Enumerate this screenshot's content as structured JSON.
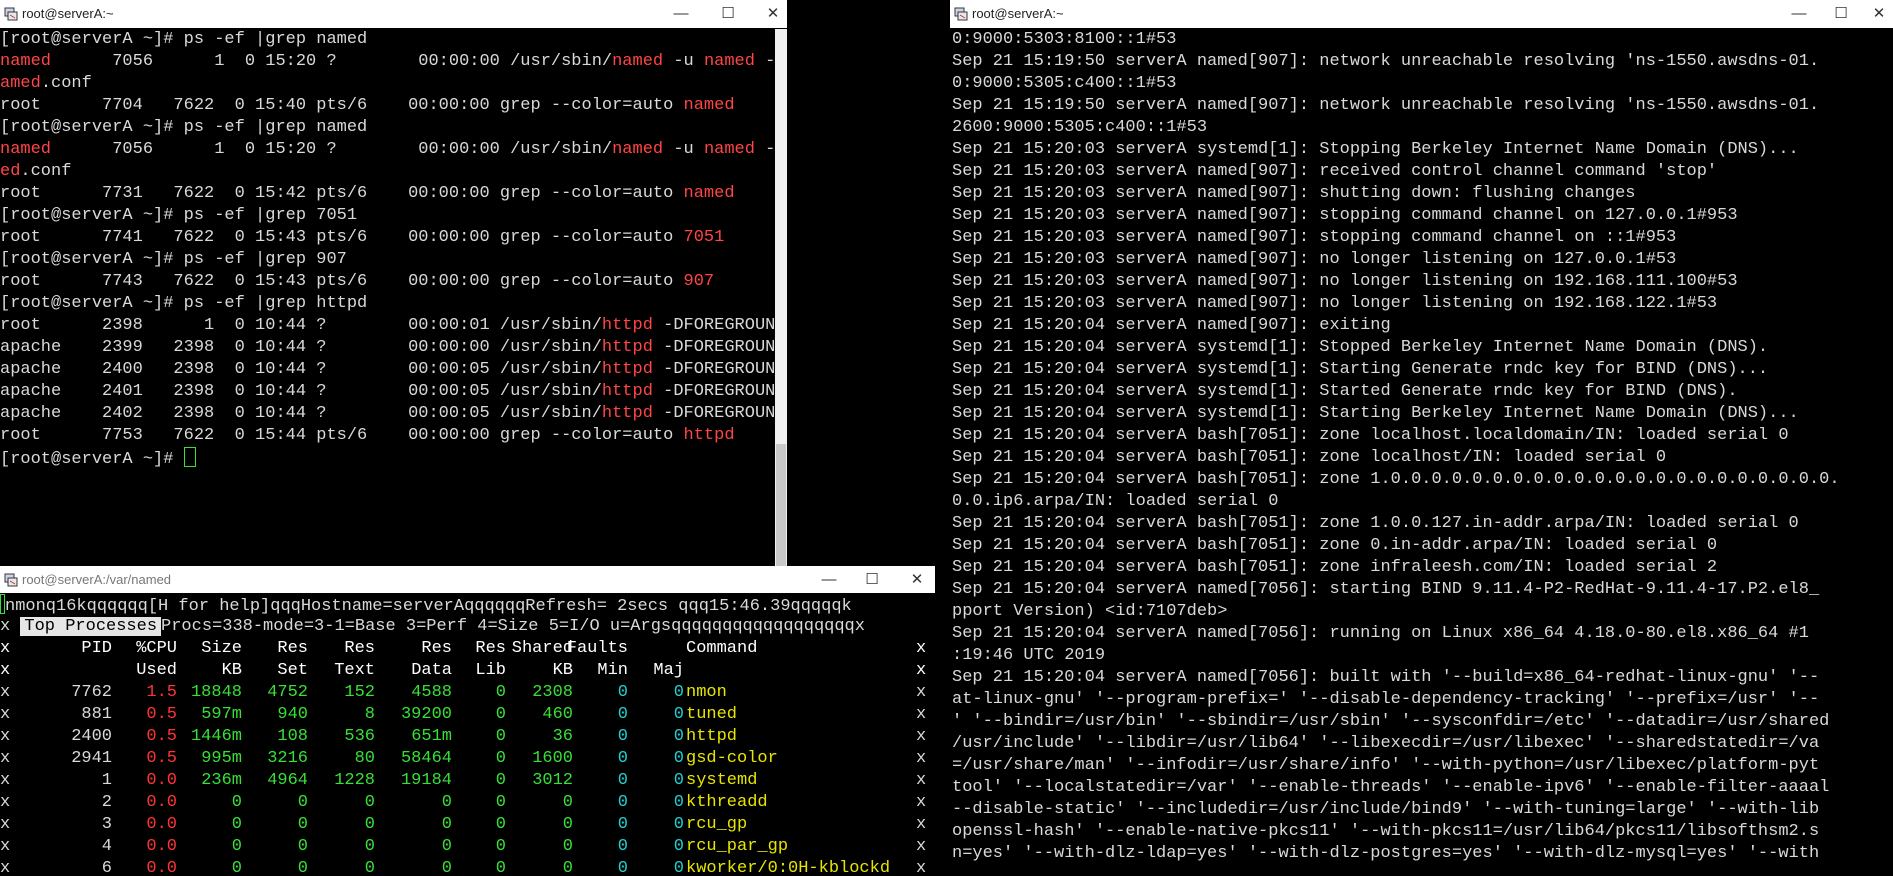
{
  "left_top": {
    "title": "root@serverA:~",
    "lines": [
      [
        [
          "[root@serverA ~]# ps -ef |grep named",
          0
        ]
      ],
      [
        [
          "named",
          1
        ],
        [
          "      7056      1  0 15:20 ?        00:00:00 /usr/sbin/",
          0
        ],
        [
          "named",
          1
        ],
        [
          " -u ",
          0
        ],
        [
          "named",
          1
        ],
        [
          " -c /etc/",
          0
        ],
        [
          "n",
          1
        ]
      ],
      [
        [
          "amed",
          1
        ],
        [
          ".conf",
          0
        ]
      ],
      [
        [
          "root      7704   7622  0 15:40 pts/6    00:00:00 grep --color=auto ",
          0
        ],
        [
          "named",
          1
        ]
      ],
      [
        [
          "[root@serverA ~]# ps -ef |grep named",
          0
        ]
      ],
      [
        [
          "named",
          1
        ],
        [
          "      7056      1  0 15:20 ?        00:00:00 /usr/sbin/",
          0
        ],
        [
          "named",
          1
        ],
        [
          " -u ",
          0
        ],
        [
          "named",
          1
        ],
        [
          " -c /etc/",
          0
        ],
        [
          "nam",
          1
        ]
      ],
      [
        [
          "ed",
          1
        ],
        [
          ".conf",
          0
        ]
      ],
      [
        [
          "root      7731   7622  0 15:42 pts/6    00:00:00 grep --color=auto ",
          0
        ],
        [
          "named",
          1
        ]
      ],
      [
        [
          "[root@serverA ~]# ps -ef |grep 7051",
          0
        ]
      ],
      [
        [
          "root      7741   7622  0 15:43 pts/6    00:00:00 grep --color=auto ",
          0
        ],
        [
          "7051",
          1
        ]
      ],
      [
        [
          "[root@serverA ~]# ps -ef |grep 907",
          0
        ]
      ],
      [
        [
          "root      7743   7622  0 15:43 pts/6    00:00:00 grep --color=auto ",
          0
        ],
        [
          "907",
          1
        ]
      ],
      [
        [
          "[root@serverA ~]# ps -ef |grep httpd",
          0
        ]
      ],
      [
        [
          "root      2398      1  0 10:44 ?        00:00:01 /usr/sbin/",
          0
        ],
        [
          "httpd",
          1
        ],
        [
          " -DFOREGROUND",
          0
        ]
      ],
      [
        [
          "apache    2399   2398  0 10:44 ?        00:00:00 /usr/sbin/",
          0
        ],
        [
          "httpd",
          1
        ],
        [
          " -DFOREGROUND",
          0
        ]
      ],
      [
        [
          "apache    2400   2398  0 10:44 ?        00:00:05 /usr/sbin/",
          0
        ],
        [
          "httpd",
          1
        ],
        [
          " -DFOREGROUND",
          0
        ]
      ],
      [
        [
          "apache    2401   2398  0 10:44 ?        00:00:05 /usr/sbin/",
          0
        ],
        [
          "httpd",
          1
        ],
        [
          " -DFOREGROUND",
          0
        ]
      ],
      [
        [
          "apache    2402   2398  0 10:44 ?        00:00:05 /usr/sbin/",
          0
        ],
        [
          "httpd",
          1
        ],
        [
          " -DFOREGROUND",
          0
        ]
      ],
      [
        [
          "root      7753   7622  0 15:44 pts/6    00:00:00 grep --color=auto ",
          0
        ],
        [
          "httpd",
          1
        ]
      ],
      [
        [
          "[root@serverA ~]# ",
          0
        ]
      ]
    ]
  },
  "left_bottom": {
    "title": "root@serverA:/var/named",
    "header_line": "nmonq16kqqqqqq[H for help]qqqHostname=serverAqqqqqqRefresh= 2secs qqq15:46.39qqqqqk",
    "top_label": "Top Processes",
    "mode_line": "Procs=338-mode=3-1=Base 3=Perf 4=Size 5=I/O u=Argsqqqqqqqqqqqqqqqqqqx",
    "col_headers_1": [
      "PID",
      "%CPU",
      "Size",
      "Res",
      "Res",
      "Res",
      "Res",
      "Shared",
      "Faults",
      "",
      "Command"
    ],
    "col_headers_2": [
      "",
      "Used",
      "KB",
      "Set",
      "Text",
      "Data",
      "Lib",
      "KB",
      "Min",
      "Maj",
      ""
    ],
    "rows": [
      {
        "pid": "7762",
        "cpu": "1.5",
        "size": "18848",
        "set": "4752",
        "text": "152",
        "data": "4588",
        "lib": "0",
        "shared": "2308",
        "min": "0",
        "maj": "0",
        "cmd": "nmon"
      },
      {
        "pid": "881",
        "cpu": "0.5",
        "size": "597m",
        "set": "940",
        "text": "8",
        "data": "39200",
        "lib": "0",
        "shared": "460",
        "min": "0",
        "maj": "0",
        "cmd": "tuned"
      },
      {
        "pid": "2400",
        "cpu": "0.5",
        "size": "1446m",
        "set": "108",
        "text": "536",
        "data": "651m",
        "lib": "0",
        "shared": "36",
        "min": "0",
        "maj": "0",
        "cmd": "httpd"
      },
      {
        "pid": "2941",
        "cpu": "0.5",
        "size": "995m",
        "set": "3216",
        "text": "80",
        "data": "58464",
        "lib": "0",
        "shared": "1600",
        "min": "0",
        "maj": "0",
        "cmd": "gsd-color"
      },
      {
        "pid": "1",
        "cpu": "0.0",
        "size": "236m",
        "set": "4964",
        "text": "1228",
        "data": "19184",
        "lib": "0",
        "shared": "3012",
        "min": "0",
        "maj": "0",
        "cmd": "systemd"
      },
      {
        "pid": "2",
        "cpu": "0.0",
        "size": "0",
        "set": "0",
        "text": "0",
        "data": "0",
        "lib": "0",
        "shared": "0",
        "min": "0",
        "maj": "0",
        "cmd": "kthreadd"
      },
      {
        "pid": "3",
        "cpu": "0.0",
        "size": "0",
        "set": "0",
        "text": "0",
        "data": "0",
        "lib": "0",
        "shared": "0",
        "min": "0",
        "maj": "0",
        "cmd": "rcu_gp"
      },
      {
        "pid": "4",
        "cpu": "0.0",
        "size": "0",
        "set": "0",
        "text": "0",
        "data": "0",
        "lib": "0",
        "shared": "0",
        "min": "0",
        "maj": "0",
        "cmd": "rcu_par_gp"
      },
      {
        "pid": "6",
        "cpu": "0.0",
        "size": "0",
        "set": "0",
        "text": "0",
        "data": "0",
        "lib": "0",
        "shared": "0",
        "min": "0",
        "maj": "0",
        "cmd": "kworker/0:0H-kblockd"
      }
    ]
  },
  "right": {
    "title": "root@serverA:~",
    "lines": [
      "0:9000:5303:8100::1#53",
      "Sep 21 15:19:50 serverA named[907]: network unreachable resolving 'ns-1550.awsdns-01.",
      "0:9000:5305:c400::1#53",
      "Sep 21 15:19:50 serverA named[907]: network unreachable resolving 'ns-1550.awsdns-01.",
      "2600:9000:5305:c400::1#53",
      "Sep 21 15:20:03 serverA systemd[1]: Stopping Berkeley Internet Name Domain (DNS)...",
      "Sep 21 15:20:03 serverA named[907]: received control channel command 'stop'",
      "Sep 21 15:20:03 serverA named[907]: shutting down: flushing changes",
      "Sep 21 15:20:03 serverA named[907]: stopping command channel on 127.0.0.1#953",
      "Sep 21 15:20:03 serverA named[907]: stopping command channel on ::1#953",
      "Sep 21 15:20:03 serverA named[907]: no longer listening on 127.0.0.1#53",
      "Sep 21 15:20:03 serverA named[907]: no longer listening on 192.168.111.100#53",
      "Sep 21 15:20:03 serverA named[907]: no longer listening on 192.168.122.1#53",
      "Sep 21 15:20:04 serverA named[907]: exiting",
      "Sep 21 15:20:04 serverA systemd[1]: Stopped Berkeley Internet Name Domain (DNS).",
      "Sep 21 15:20:04 serverA systemd[1]: Starting Generate rndc key for BIND (DNS)...",
      "Sep 21 15:20:04 serverA systemd[1]: Started Generate rndc key for BIND (DNS).",
      "Sep 21 15:20:04 serverA systemd[1]: Starting Berkeley Internet Name Domain (DNS)...",
      "Sep 21 15:20:04 serverA bash[7051]: zone localhost.localdomain/IN: loaded serial 0",
      "Sep 21 15:20:04 serverA bash[7051]: zone localhost/IN: loaded serial 0",
      "Sep 21 15:20:04 serverA bash[7051]: zone 1.0.0.0.0.0.0.0.0.0.0.0.0.0.0.0.0.0.0.0.0.0.0.",
      "0.0.ip6.arpa/IN: loaded serial 0",
      "Sep 21 15:20:04 serverA bash[7051]: zone 1.0.0.127.in-addr.arpa/IN: loaded serial 0",
      "Sep 21 15:20:04 serverA bash[7051]: zone 0.in-addr.arpa/IN: loaded serial 0",
      "Sep 21 15:20:04 serverA bash[7051]: zone infraleesh.com/IN: loaded serial 2",
      "Sep 21 15:20:04 serverA named[7056]: starting BIND 9.11.4-P2-RedHat-9.11.4-17.P2.el8_",
      "pport Version) <id:7107deb>",
      "Sep 21 15:20:04 serverA named[7056]: running on Linux x86_64 4.18.0-80.el8.x86_64 #1",
      ":19:46 UTC 2019",
      "Sep 21 15:20:04 serverA named[7056]: built with '--build=x86_64-redhat-linux-gnu' '--",
      "at-linux-gnu' '--program-prefix=' '--disable-dependency-tracking' '--prefix=/usr' '--",
      "' '--bindir=/usr/bin' '--sbindir=/usr/sbin' '--sysconfdir=/etc' '--datadir=/usr/shared",
      "/usr/include' '--libdir=/usr/lib64' '--libexecdir=/usr/libexec' '--sharedstatedir=/va",
      "=/usr/share/man' '--infodir=/usr/share/info' '--with-python=/usr/libexec/platform-pyt",
      "tool' '--localstatedir=/var' '--enable-threads' '--enable-ipv6' '--enable-filter-aaaal",
      "--disable-static' '--includedir=/usr/include/bind9' '--with-tuning=large' '--with-lib",
      "openssl-hash' '--enable-native-pkcs11' '--with-pkcs11=/usr/lib64/pkcs11/libsofthsm2.s",
      "n=yes' '--with-dlz-ldap=yes' '--with-dlz-postgres=yes' '--with-dlz-mysql=yes' '--with"
    ]
  }
}
